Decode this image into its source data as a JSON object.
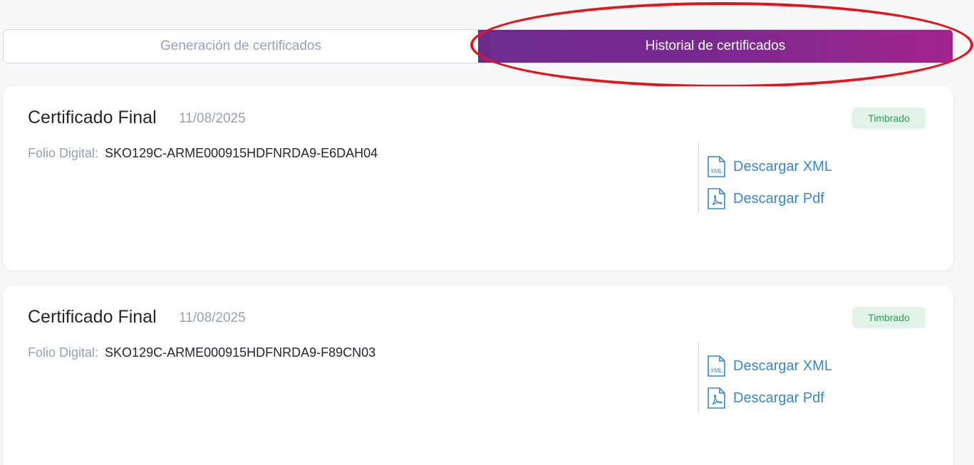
{
  "tabs": [
    {
      "label": "Generación de certificados",
      "active": false
    },
    {
      "label": "Historial de certificados",
      "active": true
    }
  ],
  "colors": {
    "accent_gradient_start": "#6e2b8e",
    "accent_gradient_end": "#a3248d",
    "link": "#3a86c8",
    "badge_bg": "#e2f3e8",
    "badge_text": "#2f9b57",
    "annotation": "#e0161b"
  },
  "cards": [
    {
      "title": "Certificado Final",
      "date": "11/08/2025",
      "status": "Timbrado",
      "folio_label": "Folio Digital:",
      "folio_value": "SKO129C-ARME000915HDFNRDA9-E6DAH04",
      "download_xml": "Descargar XML",
      "download_pdf": "Descargar Pdf",
      "xml_icon": "xml-file-icon",
      "pdf_icon": "pdf-file-icon"
    },
    {
      "title": "Certificado Final",
      "date": "11/08/2025",
      "status": "Timbrado",
      "folio_label": "Folio Digital:",
      "folio_value": "SKO129C-ARME000915HDFNRDA9-F89CN03",
      "download_xml": "Descargar XML",
      "download_pdf": "Descargar Pdf",
      "xml_icon": "xml-file-icon",
      "pdf_icon": "pdf-file-icon"
    }
  ]
}
